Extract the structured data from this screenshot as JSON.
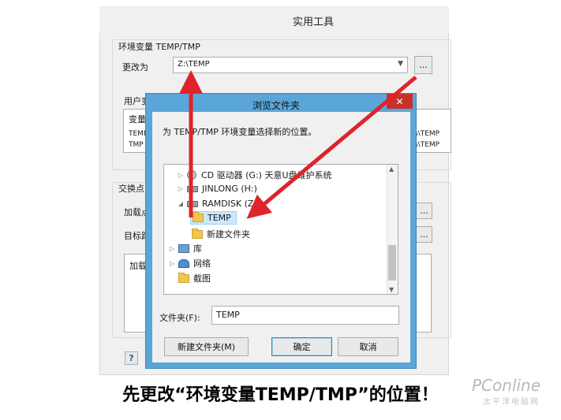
{
  "background_window": {
    "title": "实用工具",
    "env_group_label": "环境变量 TEMP/TMP",
    "change_to_label": "更改为",
    "path_value": "Z:\\TEMP",
    "browse_button": "...",
    "user_var_label": "用户变",
    "var_header": "变量",
    "var_rows": [
      {
        "name": "TEMP",
        "value": "s\\TEMP"
      },
      {
        "name": "TMP",
        "value": "s\\TEMP"
      }
    ],
    "swap_label": "交换点",
    "load_label": "加载点",
    "target_label": "目标路",
    "list_item": "加载",
    "help_button": "?"
  },
  "dialog": {
    "title": "浏览文件夹",
    "close_label": "✕",
    "instruction": "为 TEMP/TMP 环境变量选择新的位置。",
    "tree": [
      {
        "label": "CD 驱动器 (G:) 天意U盘维护系统",
        "icon": "cd-drive-icon",
        "expander": "▷"
      },
      {
        "label": "JINLONG (H:)",
        "icon": "drive-icon",
        "expander": "▷"
      },
      {
        "label": "RAMDISK (Z:)",
        "icon": "drive-icon",
        "expander": "◢"
      },
      {
        "label": "TEMP",
        "icon": "folder-icon",
        "selected": true
      },
      {
        "label": "新建文件夹",
        "icon": "folder-icon"
      },
      {
        "label": "库",
        "icon": "library-icon",
        "expander": "▷"
      },
      {
        "label": "网络",
        "icon": "network-icon",
        "expander": "▷"
      },
      {
        "label": "截图",
        "icon": "folder-icon"
      }
    ],
    "folder_label": "文件夹(F):",
    "folder_value": "TEMP",
    "new_folder_button": "新建文件夹(M)",
    "ok_button": "确定",
    "cancel_button": "取消"
  },
  "annotation": {
    "caption": "先更改“环境变量TEMP/TMP”的位置！",
    "arrow_color": "#e0232b"
  },
  "watermark": {
    "brand": "PConline",
    "sub": "太平洋电脑网"
  }
}
